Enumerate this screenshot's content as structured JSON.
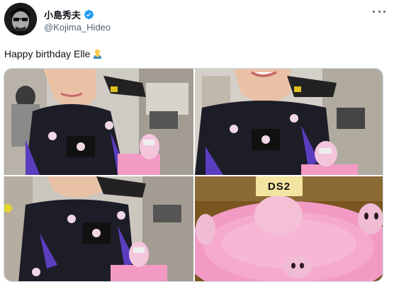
{
  "tweet": {
    "author": {
      "display_name": "小島秀夫",
      "handle": "@Kojima_Hideo",
      "verified": true,
      "avatar_icon": "avatar-photo"
    },
    "more_icon": "more-icon",
    "text": "Happy birthday Elle",
    "text_emoji": "person-bowing-emoji",
    "media": [
      {
        "label": "photo-1"
      },
      {
        "label": "photo-2"
      },
      {
        "label": "photo-3"
      },
      {
        "label": "photo-4",
        "cake_text": "DS2"
      }
    ],
    "cake_label": "DS2",
    "colors": {
      "text": "#0f1419",
      "secondary": "#536471",
      "verified": "#1d9bf0",
      "border": "#cfd9de",
      "cake_pink": "#f29ac4"
    }
  }
}
